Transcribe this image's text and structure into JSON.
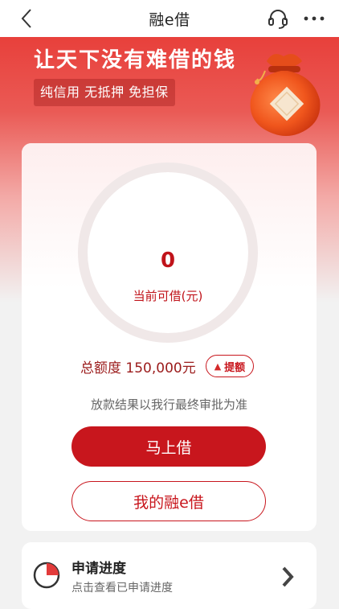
{
  "navbar": {
    "title": "融e借",
    "back_icon": "chevron-left-icon",
    "service_icon": "headset-icon",
    "more_icon": "more-dots-icon"
  },
  "banner": {
    "slogan": "让天下没有难借的钱",
    "tag": "纯信用 无抵押 免担保",
    "image_icon": "money-bag-icon"
  },
  "credit": {
    "available_value": "0",
    "available_label": "当前可借(元)",
    "total_text": "总额度 150,000元",
    "raise_button_label": "提额",
    "notice": "放款结果以我行最终审批为准"
  },
  "actions": {
    "borrow_now_label": "马上借",
    "my_loans_label": "我的融e借"
  },
  "progress": {
    "title": "申请进度",
    "subtitle": "点击查看已申请进度",
    "icon": "pie-progress-icon",
    "arrow_icon": "chevron-right-icon"
  },
  "colors": {
    "brand_red": "#c8161d",
    "banner_red": "#e8403b",
    "ring_track": "#f0e8e8"
  }
}
